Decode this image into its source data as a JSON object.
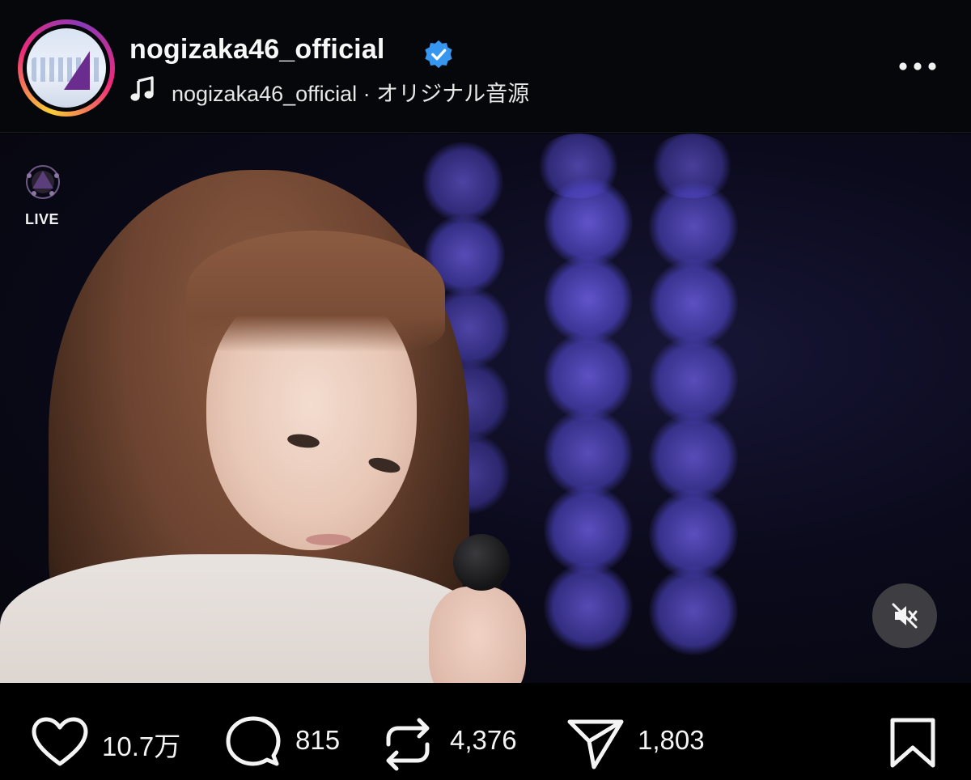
{
  "post": {
    "username": "nogizaka46_official",
    "verified": true,
    "audio_artist": "nogizaka46_official",
    "audio_separator": " · ",
    "audio_title": "オリジナル音源",
    "more_icon": "more-horizontal-icon"
  },
  "video": {
    "live_badge": "LIVE",
    "muted": true,
    "mute_icon": "speaker-muted-icon"
  },
  "actions": {
    "likes": "10.7万",
    "comments": "815",
    "reposts": "4,376",
    "shares": "1,803"
  },
  "colors": {
    "background": "#000000",
    "verified_badge": "#3797f0",
    "text": "#f5f5f5"
  }
}
